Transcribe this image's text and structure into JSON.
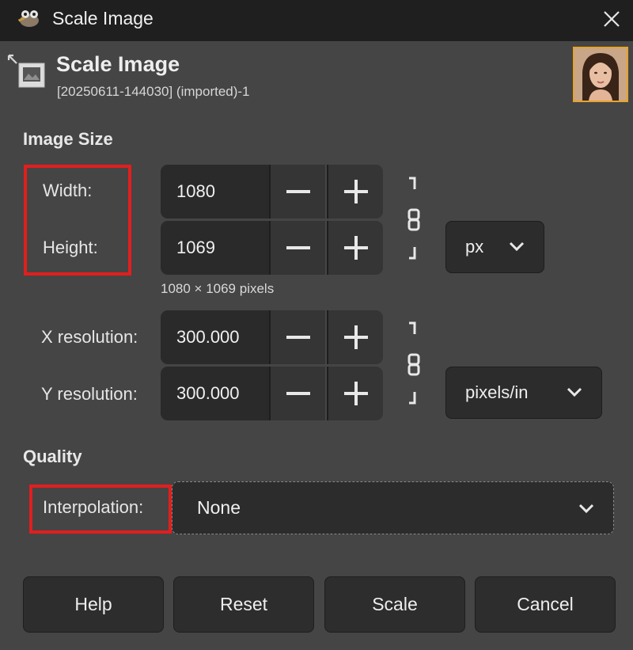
{
  "window": {
    "title": "Scale Image",
    "icons": {
      "app": "gimp-wilber-icon",
      "close": "close-icon"
    }
  },
  "header": {
    "title": "Scale Image",
    "subtitle": "[20250611-144030] (imported)-1",
    "icons": {
      "dialog": "scale-image-icon",
      "thumbnail": "image-thumbnail"
    }
  },
  "image_size": {
    "section_title": "Image Size",
    "width_label": "Width:",
    "height_label": "Height:",
    "width_value": "1080",
    "height_value": "1069",
    "unit": "px",
    "pixel_info": "1080 × 1069 pixels",
    "x_res_label": "X resolution:",
    "y_res_label": "Y resolution:",
    "x_res_value": "300.000",
    "y_res_value": "300.000",
    "res_unit": "pixels/in",
    "chain_linked": true
  },
  "quality": {
    "section_title": "Quality",
    "interpolation_label": "Interpolation:",
    "interpolation_value": "None"
  },
  "buttons": {
    "help": "Help",
    "reset": "Reset",
    "scale": "Scale",
    "cancel": "Cancel"
  },
  "highlight_color": "#e21e1e"
}
